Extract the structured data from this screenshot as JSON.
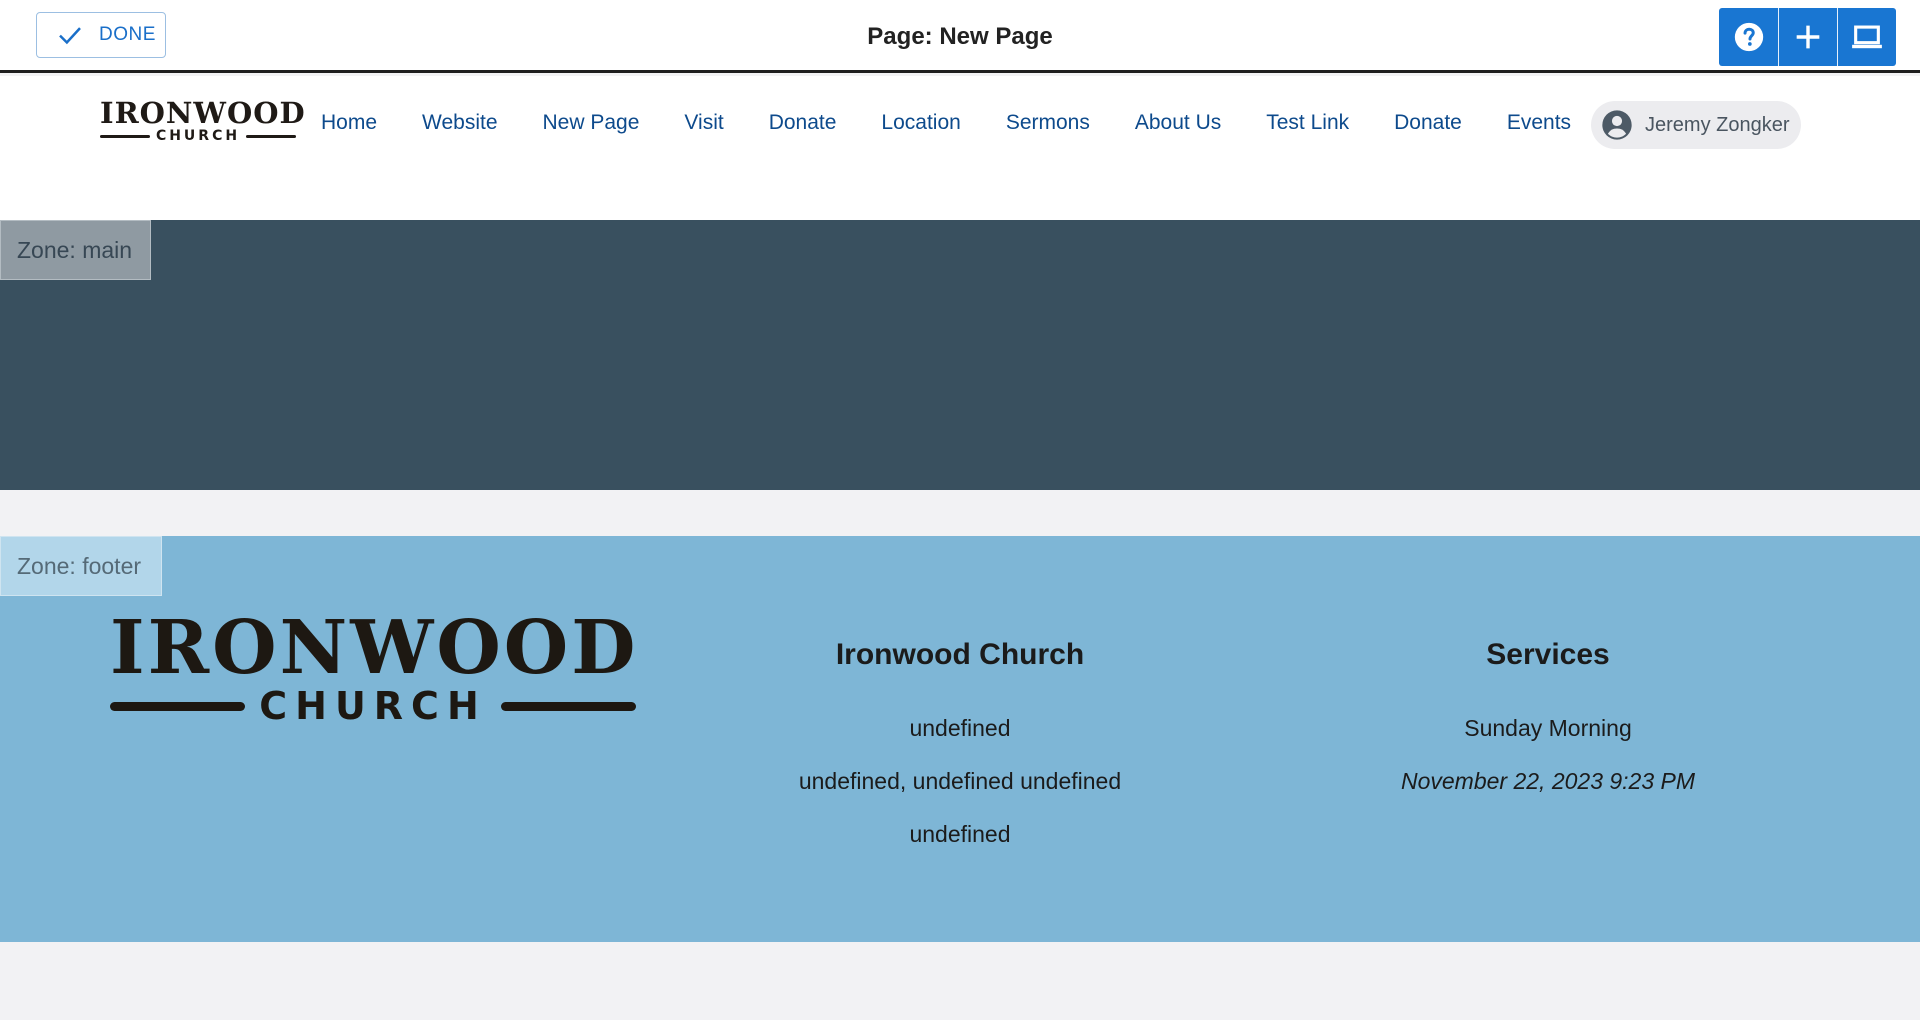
{
  "editor": {
    "done_label": "DONE",
    "title": "Page: New Page",
    "tools": [
      {
        "icon": "help-icon"
      },
      {
        "icon": "plus-icon"
      },
      {
        "icon": "laptop-icon"
      }
    ]
  },
  "header": {
    "logo": {
      "top": "IRONWOOD",
      "bottom": "CHURCH"
    },
    "nav": [
      "Home",
      "Website",
      "New Page",
      "Visit",
      "Donate",
      "Location",
      "Sermons",
      "About Us",
      "Test Link",
      "Donate",
      "Events"
    ],
    "user": {
      "name": "Jeremy Zongker",
      "icon": "account-circle-icon"
    }
  },
  "zones": {
    "main": {
      "label": "Zone: main",
      "color": "#39505f"
    },
    "footer": {
      "label": "Zone: footer",
      "color": "#7eb6d6"
    }
  },
  "footer": {
    "logo": {
      "top": "IRONWOOD",
      "bottom": "CHURCH"
    },
    "church": {
      "heading": "Ironwood Church",
      "lines": [
        "undefined",
        "undefined, undefined undefined",
        "undefined"
      ]
    },
    "services": {
      "heading": "Services",
      "service_name": "Sunday Morning",
      "service_time": "November 22, 2023 9:23 PM"
    }
  },
  "colors": {
    "accent": "#1976d2",
    "nav_link": "#0d4a8c"
  }
}
